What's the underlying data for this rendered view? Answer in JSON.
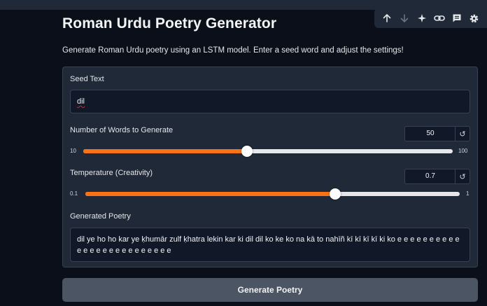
{
  "header": {
    "title": "Roman Urdu Poetry Generator",
    "description": "Generate Roman Urdu poetry using an LSTM model. Enter a seed word and adjust the settings!"
  },
  "toolbar": {
    "icons": [
      "arrow-up-icon",
      "arrow-down-icon",
      "sparkle-icon",
      "link-icon",
      "comment-icon",
      "gear-icon"
    ]
  },
  "seed": {
    "label": "Seed Text",
    "value": "dil"
  },
  "words": {
    "label": "Number of Words to Generate",
    "value": "50",
    "min": "10",
    "max": "100",
    "fraction": 0.444
  },
  "temperature": {
    "label": "Temperature (Creativity)",
    "value": "0.7",
    "min": "0.1",
    "max": "1",
    "fraction": 0.667
  },
  "output": {
    "label": "Generated Poetry",
    "value": "dil ye ho ho kar ye ḳhumār zulf ḳhatra lekin kar ki dil dil ko ke ko na kā to nahīñ kī kī kī kī ki ko e e e e e e e e e e e e e e e e e e e e e e e e e"
  },
  "actions": {
    "generate_label": "Generate Poetry"
  },
  "reset_symbol": "↺",
  "colors": {
    "background": "#0b0f19",
    "panel": "#1f2937",
    "accent": "#f97316",
    "button": "#4b5563"
  }
}
